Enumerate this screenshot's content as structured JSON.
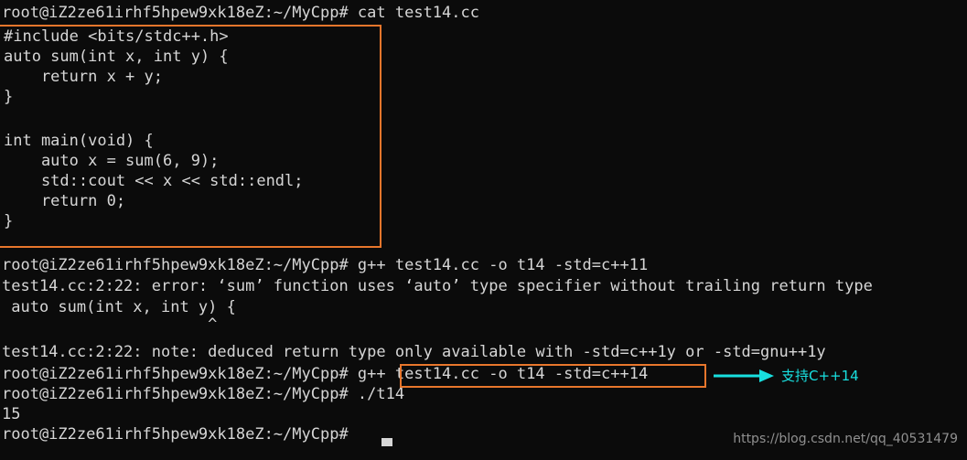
{
  "terminal": {
    "prompt": "root@iZ2ze61irhf5hpew9xk18eZ:~/MyCpp#",
    "background_color": "#0b0b0b",
    "text_color": "#d6d6d6",
    "highlight_color": "#e8762c",
    "annotation_color": "#18e0e0",
    "lines": [
      {
        "id": "l01",
        "text": "root@iZ2ze61irhf5hpew9xk18eZ:~/MyCpp# cat test14.cc"
      },
      {
        "id": "l02",
        "text": "#include <bits/stdc++.h>"
      },
      {
        "id": "l03",
        "text": "auto sum(int x, int y) {"
      },
      {
        "id": "l04",
        "text": "    return x + y;"
      },
      {
        "id": "l05",
        "text": "}"
      },
      {
        "id": "l06",
        "text": ""
      },
      {
        "id": "l07",
        "text": "int main(void) {"
      },
      {
        "id": "l08",
        "text": "    auto x = sum(6, 9);"
      },
      {
        "id": "l09",
        "text": "    std::cout << x << std::endl;"
      },
      {
        "id": "l10",
        "text": "    return 0;"
      },
      {
        "id": "l11",
        "text": "}"
      },
      {
        "id": "l12",
        "text": "root@iZ2ze61irhf5hpew9xk18eZ:~/MyCpp# g++ test14.cc -o t14 -std=c++11"
      },
      {
        "id": "l13",
        "text": "test14.cc:2:22: error: ‘sum’ function uses ‘auto’ type specifier without trailing return type"
      },
      {
        "id": "l14",
        "text": " auto sum(int x, int y) {"
      },
      {
        "id": "l15",
        "text": "                      ^"
      },
      {
        "id": "l16",
        "text": "test14.cc:2:22: note: deduced return type only available with -std=c++1y or -std=gnu++1y"
      },
      {
        "id": "l17",
        "text": "root@iZ2ze61irhf5hpew9xk18eZ:~/MyCpp# g++ test14.cc -o t14 -std=c++14"
      },
      {
        "id": "l18",
        "text": "root@iZ2ze61irhf5hpew9xk18eZ:~/MyCpp# ./t14"
      },
      {
        "id": "l19",
        "text": "15"
      },
      {
        "id": "l20",
        "text": "root@iZ2ze61irhf5hpew9xk18eZ:~/MyCpp#"
      }
    ]
  },
  "annotation": {
    "label": "支持C++14"
  },
  "watermark": {
    "text": "https://blog.csdn.net/qq_40531479"
  }
}
